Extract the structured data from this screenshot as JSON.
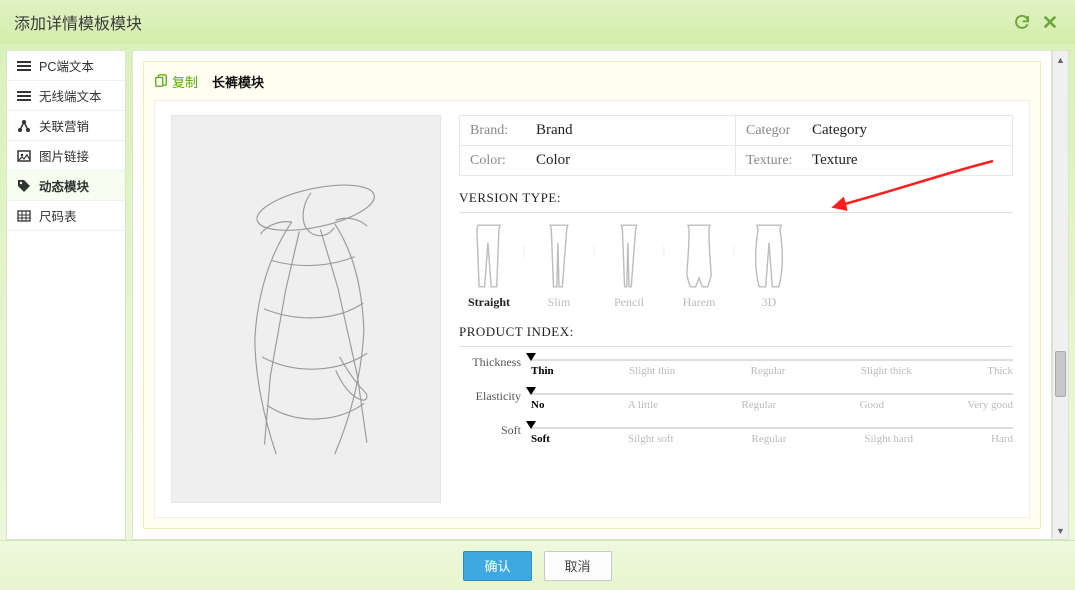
{
  "titlebar": {
    "title": "添加详情模板模块"
  },
  "sidebar": {
    "items": [
      {
        "label": "PC端文本",
        "icon": "lines-icon"
      },
      {
        "label": "无线端文本",
        "icon": "lines-icon"
      },
      {
        "label": "关联营销",
        "icon": "share-icon"
      },
      {
        "label": "图片链接",
        "icon": "image-icon"
      },
      {
        "label": "动态模块",
        "icon": "tag-icon",
        "active": true
      },
      {
        "label": "尺码表",
        "icon": "grid-icon"
      }
    ]
  },
  "canvas": {
    "copy_label": "复制",
    "module_title": "长裤模块"
  },
  "attrs": {
    "brand_k": "Brand:",
    "brand_v": "Brand",
    "categor_k": "Categor",
    "categor_v": "Category",
    "color_k": "Color:",
    "color_v": "Color",
    "texture_k": "Texture:",
    "texture_v": "Texture"
  },
  "version": {
    "title": "VERSION TYPE:",
    "types": [
      "Straight",
      "Slim",
      "Pencil",
      "Harem",
      "3D"
    ],
    "selected": "Straight"
  },
  "productIndex": {
    "title": "PRODUCT INDEX:",
    "rows": [
      {
        "key": "Thickness",
        "options": [
          "Thin",
          "Slight thin",
          "Regular",
          "Slight thick",
          "Thick"
        ],
        "selected": "Thin"
      },
      {
        "key": "Elasticity",
        "options": [
          "No",
          "A little",
          "Regular",
          "Good",
          "Very good"
        ],
        "selected": "No"
      },
      {
        "key": "Soft",
        "options": [
          "Soft",
          "Silght soft",
          "Regular",
          "Silght hard",
          "Hard"
        ],
        "selected": "Soft"
      }
    ]
  },
  "footer": {
    "ok": "确认",
    "cancel": "取消"
  }
}
